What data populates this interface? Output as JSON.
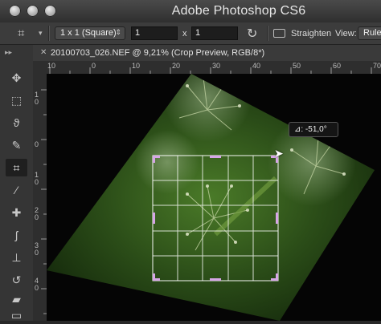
{
  "window": {
    "title": "Adobe Photoshop CS6"
  },
  "options": {
    "ratio_preset": "1 x 1 (Square)",
    "width_value": "1",
    "x_label": "x",
    "height_value": "1",
    "straighten_label": "Straighten",
    "view_label": "View:",
    "view_value": "Rule"
  },
  "document": {
    "tab_title": "20100703_026.NEF @ 9,21% (Crop Preview, RGB/8*)"
  },
  "rulers": {
    "horizontal": [
      "10",
      "0",
      "10",
      "20",
      "30",
      "40",
      "50",
      "60",
      "70"
    ],
    "vertical": [
      "1 0",
      "0",
      "1 0",
      "2 0",
      "3 0",
      "4 0"
    ]
  },
  "overlay": {
    "angle_readout": "⊿: -51,0°"
  },
  "colors": {
    "accent_handle": "#d6a6e6",
    "panel": "#353535",
    "canvas": "#050505"
  }
}
